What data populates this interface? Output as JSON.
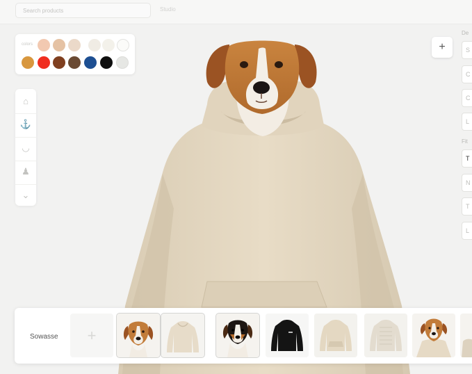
{
  "topbar": {
    "search_placeholder": "Search products",
    "hint": "Studio"
  },
  "swatches": {
    "label": "colors",
    "row1": [
      "#f2c9b1",
      "#e5c2a4",
      "#ebd9c9",
      "#f0ece4",
      "#f3f1ea",
      "#fbfbf9"
    ],
    "row2": [
      "#d8973e",
      "#f02d1f",
      "#7f3f1f",
      "#6a4a33",
      "#1d4f92",
      "#0f0f0f",
      "#e6e7e4"
    ]
  },
  "tools": [
    {
      "icon": "shirt-icon",
      "glyph": "⌂"
    },
    {
      "icon": "anchor-icon",
      "glyph": "⚓"
    },
    {
      "icon": "mouth-icon",
      "glyph": "◡"
    },
    {
      "icon": "figure-icon",
      "glyph": "♟"
    },
    {
      "icon": "chevron-down-icon",
      "glyph": "⌄"
    }
  ],
  "right_panel": {
    "add_label": "+",
    "section1": "De",
    "section2": "Fit",
    "buttons1": [
      "S",
      "C",
      "C",
      "L"
    ],
    "buttons2": [
      "T",
      "N",
      "T",
      "L"
    ]
  },
  "strip": {
    "label": "Sowasse",
    "add_label": "+"
  }
}
